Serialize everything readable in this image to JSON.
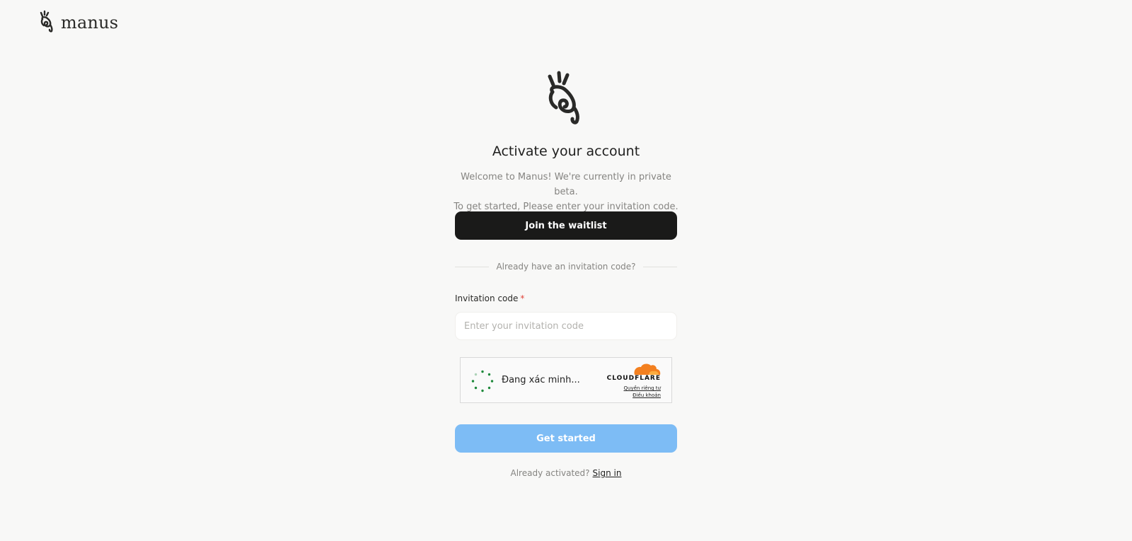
{
  "header": {
    "brand": "manus",
    "logo_icon": "manus-hand-icon"
  },
  "main": {
    "title": "Activate your account",
    "subtitle_line1": "Welcome to Manus! We're currently in private beta.",
    "subtitle_line2": "To get started, Please enter your invitation code.",
    "waitlist_button": "Join the waitlist",
    "divider_text": "Already have an invitation code?",
    "field_label": "Invitation code",
    "required_mark": "*",
    "input_placeholder": "Enter your invitation code",
    "input_value": "",
    "start_button": "Get started",
    "signin_prompt": "Already activated?",
    "signin_link": "Sign in"
  },
  "captcha": {
    "status": "Đang xác minh...",
    "brand": "CLOUDFLARE",
    "privacy_link": "Quyền riêng tư",
    "terms_link": "Điều khoản"
  },
  "colors": {
    "background": "#f8f8f7",
    "primary_button": "#1a1a19",
    "disabled_button": "#7dbcf5",
    "required": "#e0443a",
    "cloudflare_orange": "#f38020"
  }
}
